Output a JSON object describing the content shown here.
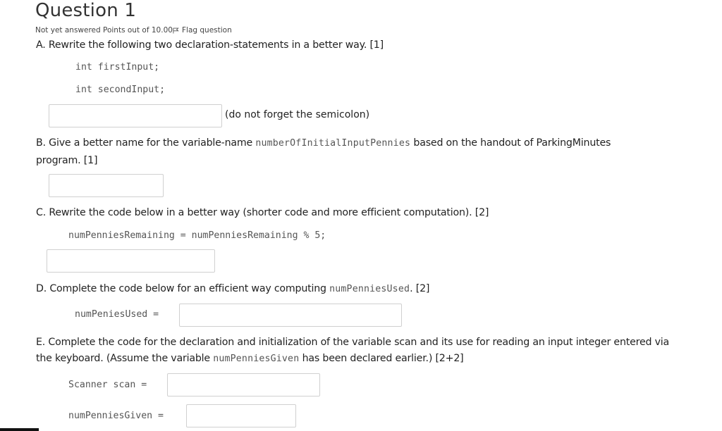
{
  "question": {
    "title": "Question 1",
    "status": "Not yet answered",
    "points": "Points out of 10.00",
    "flag_label": "Flag question"
  },
  "partA": {
    "prompt": "A. Rewrite the following two declaration-statements in a better way.  [1]",
    "code_line1": "int firstInput;",
    "code_line2": "int secondInput;",
    "answer_value": "",
    "note": "(do not forget the semicolon)"
  },
  "partB": {
    "prompt_pre": "B. Give a better name for the variable-name ",
    "variable": "numberOfInitialInputPennies",
    "prompt_post": " based on the handout of ParkingMinutes",
    "prompt_line2": "program.  [1]",
    "answer_value": ""
  },
  "partC": {
    "prompt": "C. Rewrite the code below in a better way (shorter code and more efficient computation).  [2]",
    "code": "numPenniesRemaining = numPenniesRemaining % 5;",
    "answer_value": ""
  },
  "partD": {
    "prompt_pre": "D. Complete the code below for an efficient way computing ",
    "variable": "numPenniesUsed",
    "prompt_post": ".  [2]",
    "code_label": "numPeniesUsed =",
    "answer_value": ""
  },
  "partE": {
    "prompt_line1": "E. Complete the code for the declaration and initialization of the variable scan and its use for reading an input integer entered via",
    "prompt_line2_pre": "the keyboard.  (Assume the variable ",
    "variable": "numPenniesGiven",
    "prompt_line2_post": " has been declared earlier.) [2+2]",
    "code_label1": "Scanner scan =",
    "code_label2": "numPenniesGiven =",
    "answer1_value": "",
    "answer2_value": ""
  }
}
